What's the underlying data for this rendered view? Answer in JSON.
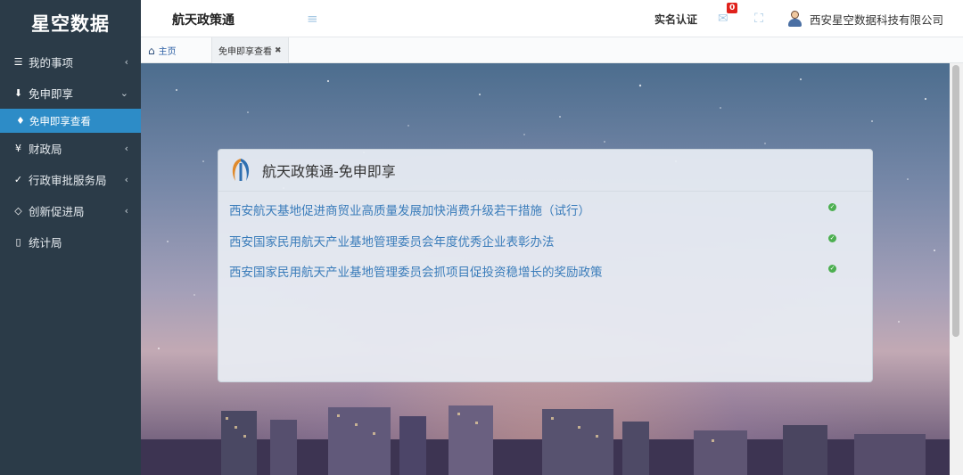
{
  "brand": "星空数据",
  "sidebar": {
    "items": [
      {
        "label": "我的事项",
        "icon": "list-icon"
      },
      {
        "label": "免申即享",
        "icon": "download-icon"
      },
      {
        "label": "免申即享查看",
        "icon": "tag-icon"
      },
      {
        "label": "财政局",
        "icon": "yen-icon"
      },
      {
        "label": "行政审批服务局",
        "icon": "check-square-icon"
      },
      {
        "label": "创新促进局",
        "icon": "diamond-icon"
      },
      {
        "label": "统计局",
        "icon": "document-icon"
      }
    ]
  },
  "header": {
    "app_title": "航天政策通",
    "real_name_auth": "实名认证",
    "notification_count": "0",
    "company": "西安星空数据科技有限公司"
  },
  "tabs": {
    "home": "主页",
    "active": "免申即享查看"
  },
  "panel": {
    "title": "航天政策通-免申即享",
    "policies": [
      "西安航天基地促进商贸业高质量发展加快消费升级若干措施（试行）",
      "西安国家民用航天产业基地管理委员会年度优秀企业表彰办法",
      "西安国家民用航天产业基地管理委员会抓项目促投资稳增长的奖励政策"
    ]
  },
  "colors": {
    "sidebar_bg": "#2b3b48",
    "active_sub_bg": "#2d8cc7",
    "link": "#3a7cba",
    "status_ok": "#4caf50",
    "badge": "#e0221c"
  }
}
